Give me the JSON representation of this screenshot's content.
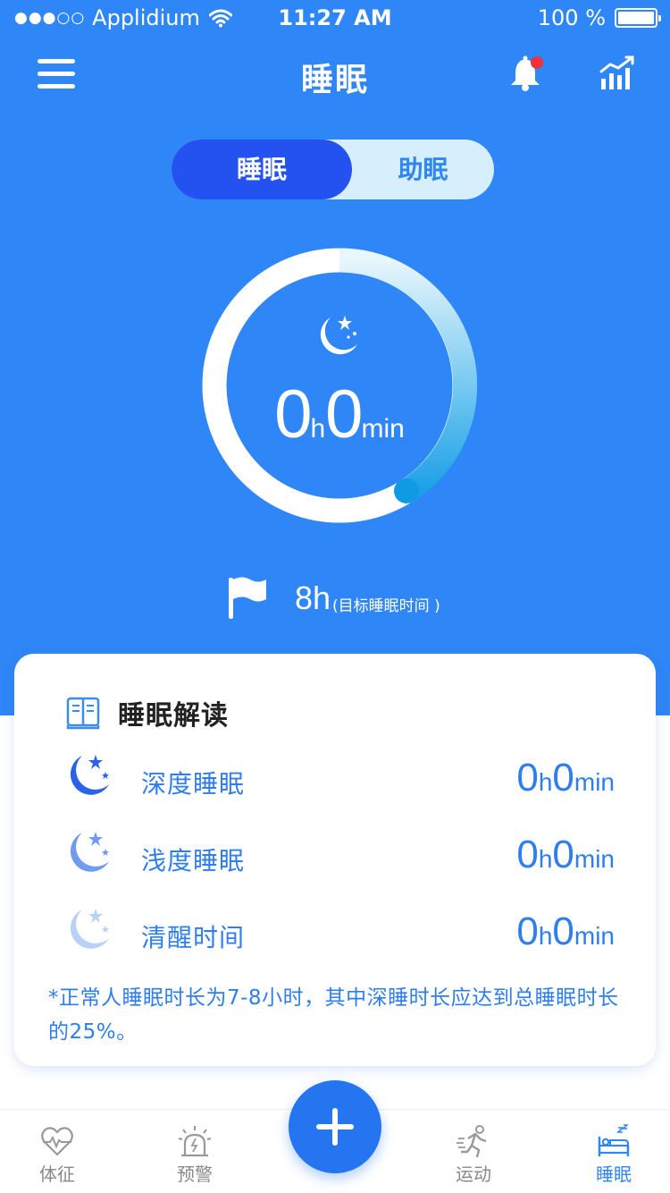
{
  "status_bar": {
    "signal": "●●●○○",
    "carrier": "Applidium",
    "time": "11:27 AM",
    "battery": "100 %"
  },
  "nav": {
    "title": "睡眠",
    "menu_icon": "hamburger-icon",
    "bell_icon": "bell-icon",
    "stats_icon": "bar-chart-icon",
    "notification_dot_color": "#f0323c"
  },
  "segment": {
    "active": "睡眠",
    "inactive": "助眠"
  },
  "summary": {
    "hours": "0",
    "hour_unit": "h",
    "minutes": "0",
    "minute_unit": "min",
    "icon": "moon-stars-icon"
  },
  "goal": {
    "value": "8h",
    "note": "(目标睡眠时间 )",
    "icon": "flag-icon"
  },
  "card": {
    "title": "睡眠解读",
    "icon": "book-icon",
    "rows": [
      {
        "label": "深度睡眠",
        "hours": "0",
        "hour_unit": "h",
        "minutes": "0",
        "minute_unit": "min",
        "color": "#2a63e8"
      },
      {
        "label": "浅度睡眠",
        "hours": "0",
        "hour_unit": "h",
        "minutes": "0",
        "minute_unit": "min",
        "color": "#6f9bf0"
      },
      {
        "label": "清醒时间",
        "hours": "0",
        "hour_unit": "h",
        "minutes": "0",
        "minute_unit": "min",
        "color": "#b9d0f7"
      }
    ],
    "note": "*正常人睡眠时长为7-8小时，其中深睡时长应达到总睡眠时长的25%。"
  },
  "tabs": [
    {
      "label": "体征",
      "icon": "heart-pulse-icon",
      "active": false
    },
    {
      "label": "预警",
      "icon": "alarm-light-icon",
      "active": false
    },
    {
      "label": "运动",
      "icon": "running-icon",
      "active": false
    },
    {
      "label": "睡眠",
      "icon": "bed-icon",
      "active": true
    }
  ],
  "fab": {
    "icon": "plus-icon"
  },
  "colors": {
    "primary": "#2f86f6",
    "segment_active": "#2452f0",
    "segment_bg": "#d7effc",
    "text_blue": "#2f7ef0"
  }
}
